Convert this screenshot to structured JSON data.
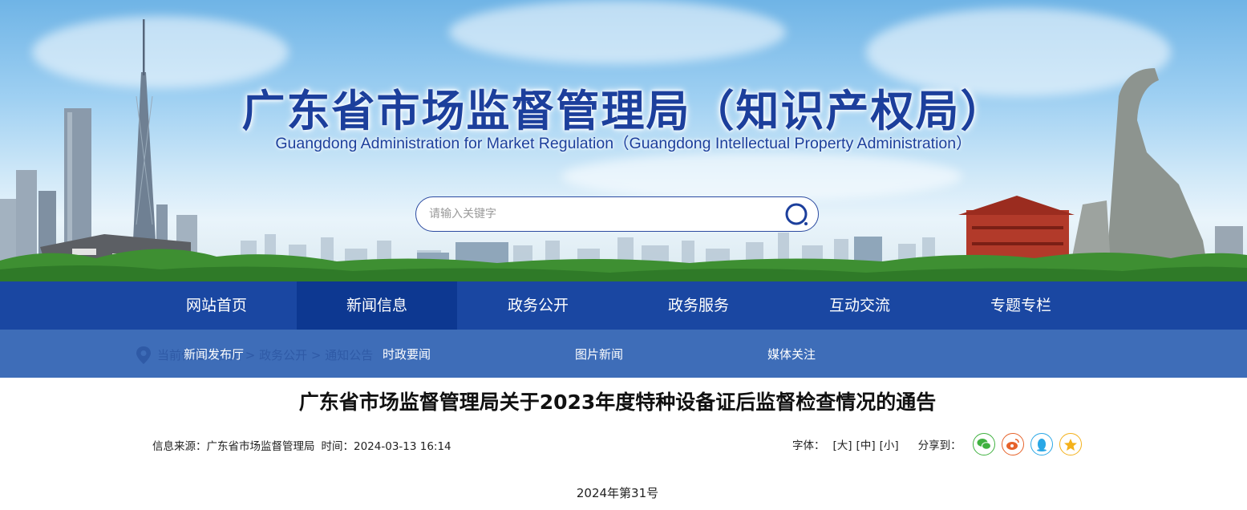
{
  "header": {
    "title": "广东省市场监督管理局（知识产权局）",
    "subtitle": "Guangdong Administration for Market Regulation（Guangdong Intellectual Property Administration）"
  },
  "search": {
    "placeholder": "请输入关键字",
    "icon": "search-icon"
  },
  "nav": {
    "items": [
      "网站首页",
      "新闻信息",
      "政务公开",
      "政务服务",
      "互动交流",
      "专题专栏"
    ],
    "active": "新闻信息"
  },
  "subnav": {
    "items": [
      "新闻发布厅",
      "时政要闻",
      "图片新闻",
      "媒体关注"
    ],
    "breadcrumb_ghost": "当前位置：首页 > 政务公开 > 通知公告"
  },
  "article": {
    "title": "广东省市场监督管理局关于2023年度特种设备证后监督检查情况的通告",
    "source_label": "信息来源：广东省市场监督管理局",
    "time_label": "时间：2024-03-13 16:14",
    "doc_number": "2024年第31号"
  },
  "tools": {
    "font_label": "字体：",
    "size_large": "[大]",
    "size_medium": "[中]",
    "size_small": "[小]",
    "share_label": "分享到：",
    "share_icons": [
      {
        "name": "wechat-icon",
        "color": "#3fb13f"
      },
      {
        "name": "weibo-icon",
        "color": "#e6622a"
      },
      {
        "name": "qq-icon",
        "color": "#2aa7e6"
      },
      {
        "name": "qzone-icon",
        "color": "#f4b11b"
      }
    ]
  },
  "colors": {
    "nav_bg": "#1a47a2",
    "nav_active": "#0d3891",
    "subnav_bg": "#3e6db8",
    "title_blue": "#1c3f9c"
  }
}
